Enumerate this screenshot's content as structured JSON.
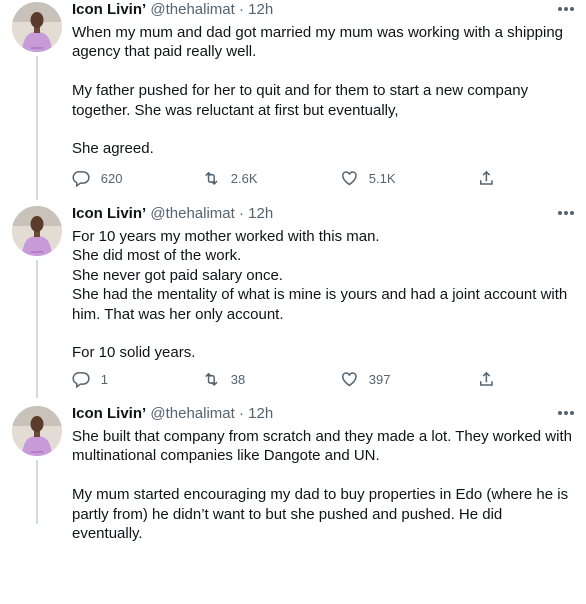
{
  "author": {
    "name": "Icon Livin’",
    "handle": "@thehalimat",
    "separator": "·"
  },
  "colors": {
    "text": "#0f1419",
    "muted": "#536471",
    "line": "#cfd9de",
    "avatar_bg": "#d9d3cc",
    "shirt": "#c89ad8"
  },
  "tweets": [
    {
      "time": "12h",
      "paragraphs": [
        [
          "When my mum and dad got married my mum was working with a shipping agency that paid really well."
        ],
        [
          "My father pushed for her to quit and for them to start a new company together. She was reluctant at first but eventually,"
        ],
        [
          "She agreed."
        ]
      ],
      "replies": "620",
      "retweets": "2.6K",
      "likes": "5.1K"
    },
    {
      "time": "12h",
      "paragraphs": [
        [
          "For 10 years my mother worked with this man.",
          "She did most of the work.",
          "She never got paid salary once.",
          "She had the mentality of what is mine is yours and had a joint account with him. That was her only account."
        ],
        [
          "For 10 solid years."
        ]
      ],
      "replies": "1",
      "retweets": "38",
      "likes": "397"
    },
    {
      "time": "12h",
      "paragraphs": [
        [
          "She built that company from scratch and they made a lot. They worked with multinational companies like Dangote and UN."
        ],
        [
          "My mum started encouraging my dad to buy properties in Edo (where he is partly from) he didn’t want to but she pushed and pushed. He did eventually."
        ]
      ],
      "replies": "",
      "retweets": "",
      "likes": ""
    }
  ],
  "icons": {
    "reply": "reply-icon",
    "retweet": "retweet-icon",
    "like": "heart-icon",
    "share": "share-icon",
    "more": "more-options-icon"
  }
}
